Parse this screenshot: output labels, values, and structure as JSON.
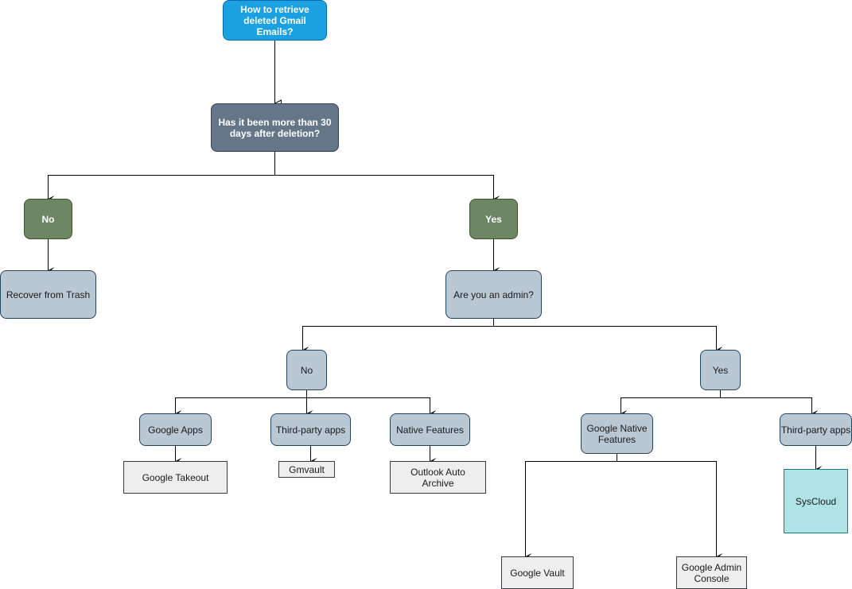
{
  "diagram": {
    "title": "How to retrieve deleted Gmail Emails?",
    "nodes": {
      "root": "How to retrieve deleted Gmail Emails?",
      "q_30days": "Has it been more than 30 days after deletion?",
      "no_30": "No",
      "yes_30": "Yes",
      "recover_trash": "Recover from Trash",
      "q_admin": "Are you an admin?",
      "no_admin": "No",
      "yes_admin": "Yes",
      "google_apps": "Google Apps",
      "third_party_user": "Third-party apps",
      "native_features": "Native Features",
      "google_takeout": "Google Takeout",
      "gmvault": "Gmvault",
      "outlook_archive": "Outlook Auto Archive",
      "google_native": "Google Native Features",
      "third_party_admin": "Third-party apps",
      "syscloud": "SysCloud",
      "google_vault": "Google Vault",
      "google_admin_console": "Google Admin Console"
    },
    "edges": [
      {
        "from": "root",
        "to": "q_30days"
      },
      {
        "from": "q_30days",
        "to": "no_30"
      },
      {
        "from": "q_30days",
        "to": "yes_30"
      },
      {
        "from": "no_30",
        "to": "recover_trash"
      },
      {
        "from": "yes_30",
        "to": "q_admin"
      },
      {
        "from": "q_admin",
        "to": "no_admin"
      },
      {
        "from": "q_admin",
        "to": "yes_admin"
      },
      {
        "from": "no_admin",
        "to": "google_apps"
      },
      {
        "from": "no_admin",
        "to": "third_party_user"
      },
      {
        "from": "no_admin",
        "to": "native_features"
      },
      {
        "from": "google_apps",
        "to": "google_takeout"
      },
      {
        "from": "third_party_user",
        "to": "gmvault"
      },
      {
        "from": "native_features",
        "to": "outlook_archive"
      },
      {
        "from": "yes_admin",
        "to": "google_native"
      },
      {
        "from": "yes_admin",
        "to": "third_party_admin"
      },
      {
        "from": "third_party_admin",
        "to": "syscloud"
      },
      {
        "from": "google_native",
        "to": "google_vault"
      },
      {
        "from": "google_native",
        "to": "google_admin_console"
      }
    ]
  }
}
